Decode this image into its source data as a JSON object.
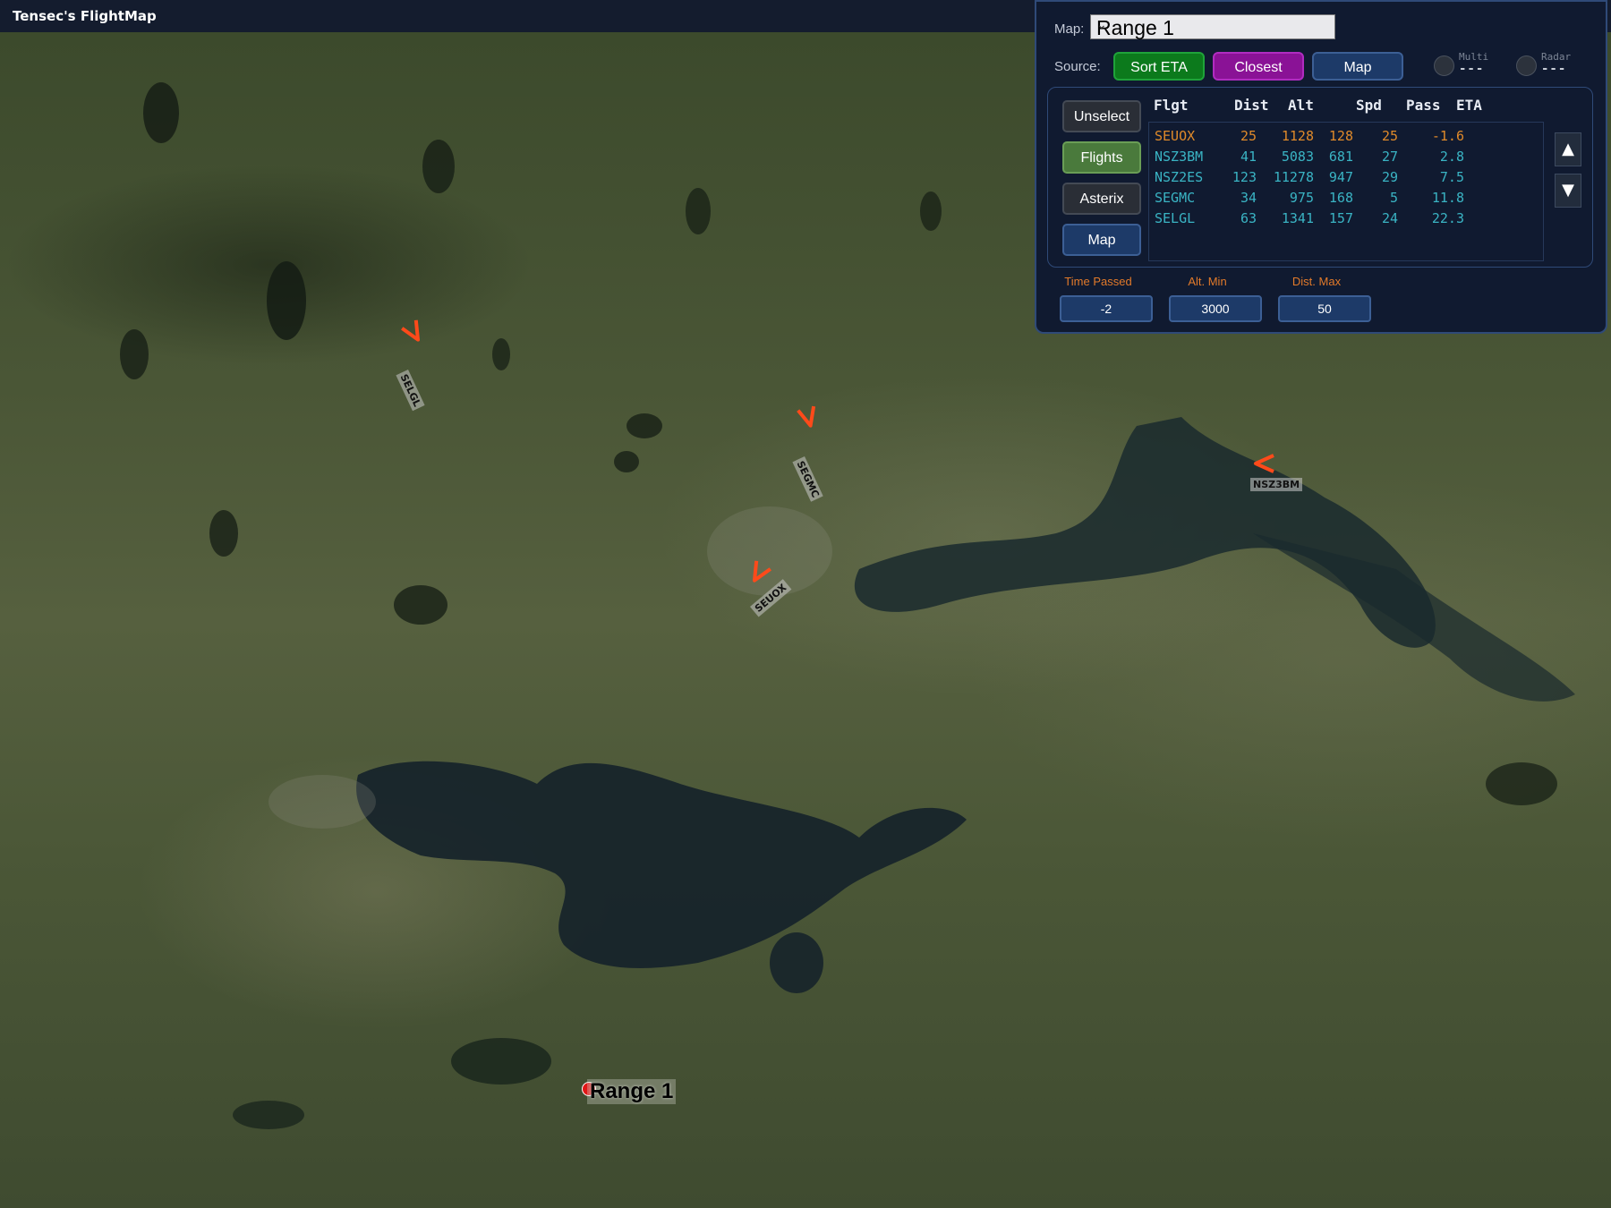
{
  "app": {
    "title": "Tensec's FlightMap"
  },
  "panel": {
    "map_label": "Map:",
    "map_select": {
      "value": "Range 1"
    },
    "source_label": "Source:",
    "source_buttons": [
      "Sort ETA",
      "Closest",
      "Map"
    ],
    "indicators": [
      {
        "label": "Multi",
        "value": "---"
      },
      {
        "label": "Radar",
        "value": "---"
      }
    ],
    "side_buttons": [
      "Unselect",
      "Flights",
      "Asterix",
      "Map"
    ],
    "table": {
      "columns": [
        "Flgt",
        "Dist",
        "Alt",
        "Spd",
        "Pass",
        "ETA"
      ],
      "rows": [
        {
          "flgt": "SEUOX",
          "dist": "25",
          "alt": "1128",
          "spd": "128",
          "pass": "25",
          "eta": "-1.6"
        },
        {
          "flgt": "NSZ3BM",
          "dist": "41",
          "alt": "5083",
          "spd": "681",
          "pass": "27",
          "eta": "2.8"
        },
        {
          "flgt": "NSZ2ES",
          "dist": "123",
          "alt": "11278",
          "spd": "947",
          "pass": "29",
          "eta": "7.5"
        },
        {
          "flgt": "SEGMC",
          "dist": "34",
          "alt": "975",
          "spd": "168",
          "pass": "5",
          "eta": "11.8"
        },
        {
          "flgt": "SELGL",
          "dist": "63",
          "alt": "1341",
          "spd": "157",
          "pass": "24",
          "eta": "22.3"
        }
      ],
      "selected_row": 0,
      "scroll_up": "▲",
      "scroll_down": "▼"
    },
    "filters": [
      {
        "label": "Time Passed",
        "value": "-2"
      },
      {
        "label": "Alt. Min",
        "value": "3000"
      },
      {
        "label": "Dist. Max",
        "value": "50"
      }
    ]
  },
  "map": {
    "aircraft": [
      {
        "callsign": "SELGL",
        "icon": "aircraft-arrow-icon"
      },
      {
        "callsign": "SEGMC",
        "icon": "aircraft-arrow-icon"
      },
      {
        "callsign": "SEUOX",
        "icon": "aircraft-arrow-icon"
      },
      {
        "callsign": "NSZ3BM",
        "icon": "aircraft-arrow-icon"
      }
    ],
    "marker": {
      "label": "Range 1"
    }
  },
  "colors": {
    "panel_bg": "#101a30",
    "accent_orange": "#e08a2a",
    "accent_cyan": "#3ab4c4",
    "aircraft": "#ff4a1a",
    "marker": "#e01818"
  }
}
